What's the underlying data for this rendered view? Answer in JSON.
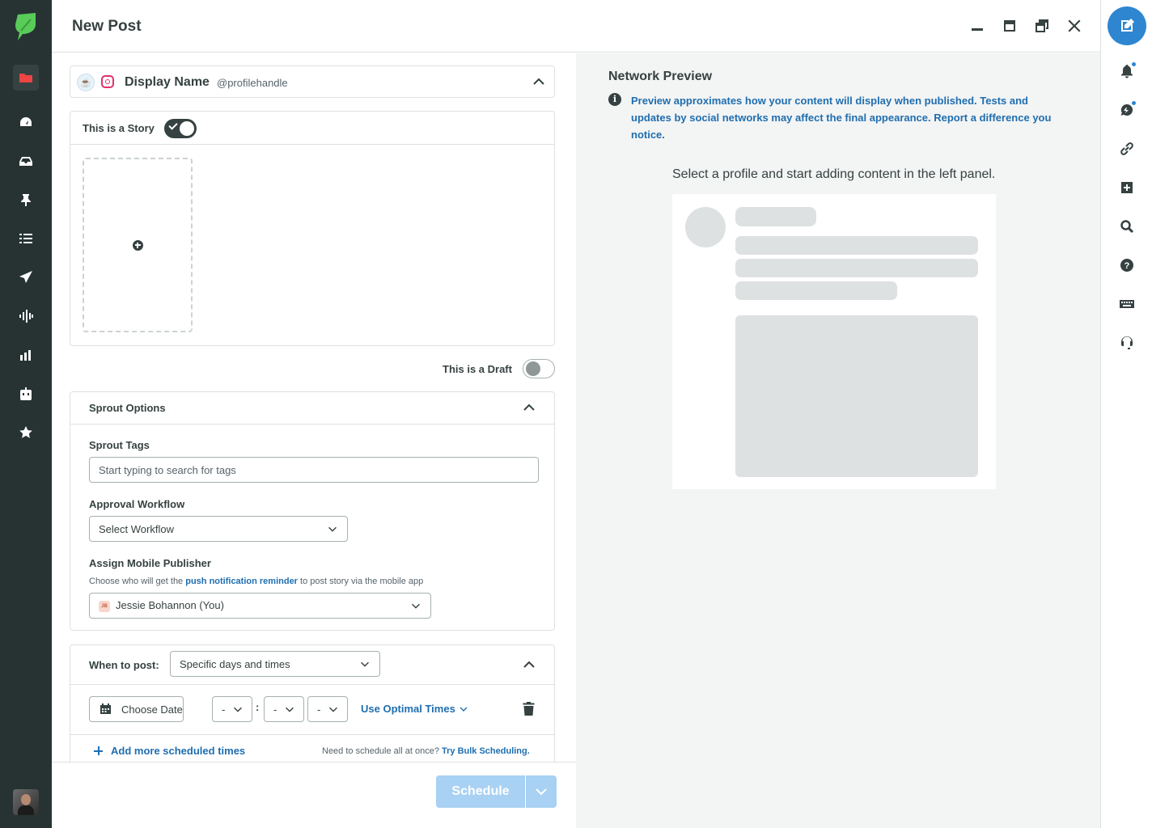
{
  "header": {
    "title": "New Post"
  },
  "profile": {
    "display_name": "Display Name",
    "handle": "@profilehandle",
    "network_icon": "instagram-icon"
  },
  "story": {
    "toggle_label": "This is a Story",
    "enabled": true
  },
  "draft": {
    "toggle_label": "This is a Draft",
    "enabled": false
  },
  "sprout_options": {
    "title": "Sprout Options",
    "tags_label": "Sprout Tags",
    "tags_placeholder": "Start typing to search for tags",
    "approval_label": "Approval Workflow",
    "approval_value": "Select Workflow",
    "publisher_label": "Assign Mobile Publisher",
    "publisher_help_prefix": "Choose who will get the ",
    "publisher_help_link": "push notification reminder",
    "publisher_help_suffix": " to post story via the mobile app",
    "publisher_initials": "JB",
    "publisher_value": "Jessie Bohannon (You)"
  },
  "when": {
    "label": "When to post:",
    "mode_value": "Specific days and times",
    "date_placeholder": "Choose Date",
    "hour_value": "-",
    "minute_value": "-",
    "ampm_value": "-",
    "optimal_label": "Use Optimal Times",
    "add_more_label": "Add more scheduled times",
    "bulk_prefix": "Need to schedule all at once?",
    "bulk_link": "Try Bulk Scheduling."
  },
  "footer": {
    "schedule_label": "Schedule"
  },
  "preview": {
    "title": "Network Preview",
    "note": "Preview approximates how your content will display when published. Tests and updates by social networks may affect the final appearance. Report a difference you notice.",
    "empty_message": "Select a profile and start adding content in the left panel."
  },
  "left_nav": [
    {
      "icon": "folder-icon",
      "active": true
    },
    {
      "icon": "dashboard-icon",
      "active": false
    },
    {
      "icon": "inbox-icon",
      "active": false
    },
    {
      "icon": "pin-icon",
      "active": false
    },
    {
      "icon": "list-icon",
      "active": false
    },
    {
      "icon": "send-icon",
      "active": false
    },
    {
      "icon": "listening-icon",
      "active": false
    },
    {
      "icon": "reports-icon",
      "active": false
    },
    {
      "icon": "bot-icon",
      "active": false
    },
    {
      "icon": "reviews-icon",
      "active": false
    }
  ],
  "right_rail": [
    "compose-icon",
    "bell-icon",
    "messages-icon",
    "link-icon",
    "plus-square-icon",
    "search-icon",
    "help-icon",
    "keyboard-icon",
    "support-icon"
  ],
  "colors": {
    "nav_bg": "#273333",
    "accent": "#2e86d1",
    "link": "#1f6eb0",
    "schedule_disabled": "#a8d1f3",
    "preview_bg": "#f3f4f4",
    "skeleton": "#dee1e1"
  }
}
